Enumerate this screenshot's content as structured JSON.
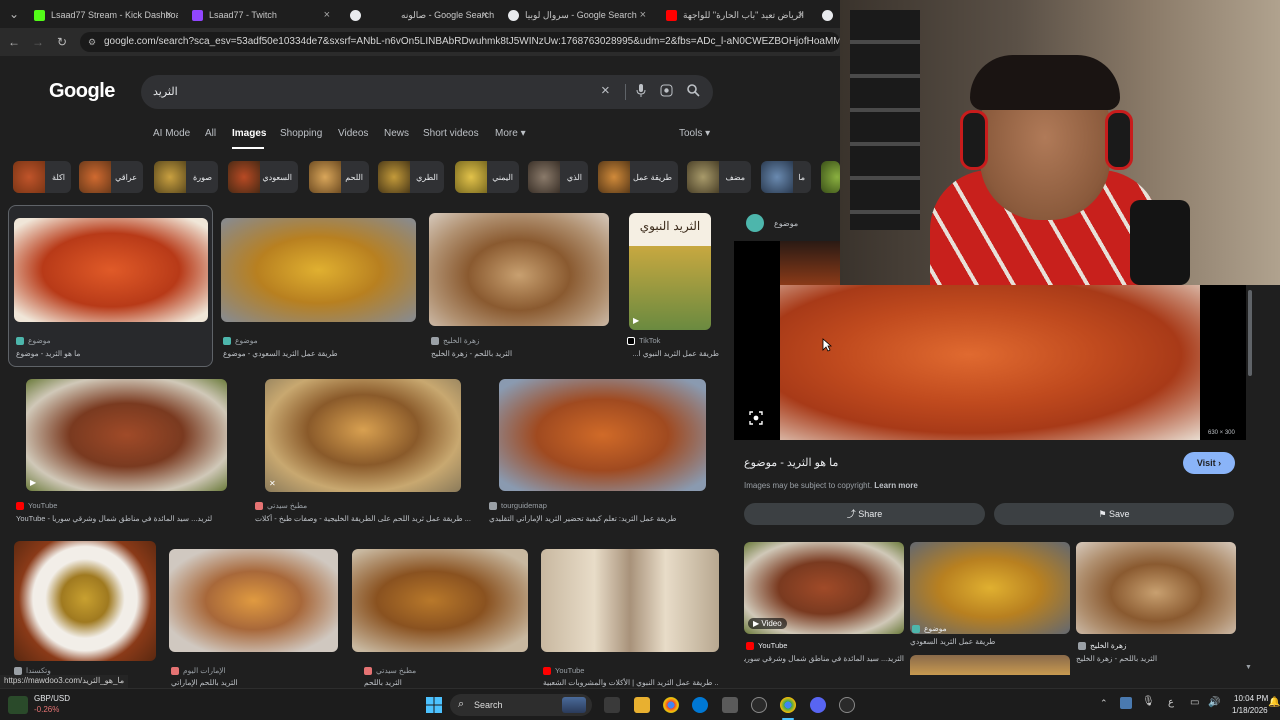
{
  "browser": {
    "tabs": [
      {
        "label": "Lsaad77 Stream - Kick Dashboa",
        "favicon_color": "#53fc18"
      },
      {
        "label": "Lsaad77 - Twitch",
        "favicon_color": "#9146ff"
      },
      {
        "label": "صالونه - Google Search",
        "favicon_color": "#4285f4"
      },
      {
        "label": "سروال لوبيا - Google Search",
        "favicon_color": "#4285f4"
      },
      {
        "label": "الرياض تعيد \"باب الحارة\" للواجهة",
        "favicon_color": "#ff0000"
      }
    ],
    "url": "google.com/search?sca_esv=53adf50e10334de7&sxsrf=ANbL-n6vOn5LINBAbRDwuhmk8tJ5WINzUw:1768763028995&udm=2&fbs=ADc_l-aN0CWEZBOHjofHoaMMDiKpaEWjvZ2F"
  },
  "google": {
    "logo": "Google",
    "query": "الثريد",
    "nav": [
      "AI Mode",
      "All",
      "Images",
      "Shopping",
      "Videos",
      "News",
      "Short videos",
      "More",
      "Tools"
    ],
    "chips": [
      "اكلة",
      "عراقي",
      "صورة",
      "السعودي",
      "اللحم",
      "الطري",
      "اليمني",
      "الذي",
      "طريقة عمل",
      "مضف",
      "ما"
    ]
  },
  "results": {
    "row1": [
      {
        "source": "موضوع",
        "caption": "ما هو الثريد - موضوع",
        "color": "#4db6ac"
      },
      {
        "source": "موضوع",
        "caption": "طريقة عمل الثريد السعودي - موضوع",
        "color": "#4db6ac"
      },
      {
        "source": "زهرة الخليج",
        "caption": "الثريد باللحم - زهرة الخليج",
        "color": "#9aa0a6"
      },
      {
        "source": "TikTok",
        "caption": "طريقة عمل الثريد النبوي ا...",
        "color": "#ffffff",
        "overlay": "الثريد النبوي"
      }
    ],
    "row2": [
      {
        "source": "YouTube",
        "caption": "YouTube - الثريد... سيد المائدة في مناطق شمال وشرقي سوريا",
        "color": "#ff0000"
      },
      {
        "source": "مطبخ سيدتي",
        "caption": "طريقة عمل ثريد اللحم على الطريقة الخليجية - وصفات طبخ - أكلات ...",
        "color": "#e57373"
      },
      {
        "source": "tourguidemap",
        "caption": "طريقة عمل الثريد: تعلم كيفية تحضير الثريد الإماراتي التقليدي",
        "color": "#9aa0a6"
      }
    ],
    "row3": [
      {
        "source": "وتكسندا",
        "caption": "",
        "color": "#9aa0a6"
      },
      {
        "source": "الإمارات اليوم",
        "caption": "الثريد باللحم الإماراتي",
        "color": "#e57373"
      },
      {
        "source": "مطبخ سيدتي",
        "caption": "الثريد باللحم",
        "color": "#e57373"
      },
      {
        "source": "YouTube",
        "caption": "طريقة عمل الثريد النبوي | الأكلات والمشروبات الشعبية ...",
        "color": "#ff0000"
      }
    ]
  },
  "panel": {
    "source": "موضوع",
    "title": "ما هو الثريد - موضوع",
    "visit_label": "Visit",
    "copyright": "Images may be subject to copyright.",
    "learn_more": "Learn more",
    "share_label": "Share",
    "save_label": "Save",
    "dimensions": "630 × 300",
    "related": [
      {
        "source": "YouTube",
        "caption": "الثريد... سيد المائدة في مناطق شمال وشرقي سوريا",
        "badge": "Video"
      },
      {
        "source": "موضوع",
        "caption": "طريقة عمل الثريد السعودي",
        "badge": ""
      },
      {
        "source": "زهرة الخليج",
        "caption": "الثريد باللحم - زهرة الخليج",
        "badge": ""
      }
    ]
  },
  "status_url": "https://mawdoo3.com/ما_هو_الثريد",
  "taskbar": {
    "ticker_label": "GBP/USD",
    "ticker_change": "-0.26%",
    "search_label": "Search",
    "time": "10:04 PM",
    "date": "1/18/2026"
  }
}
